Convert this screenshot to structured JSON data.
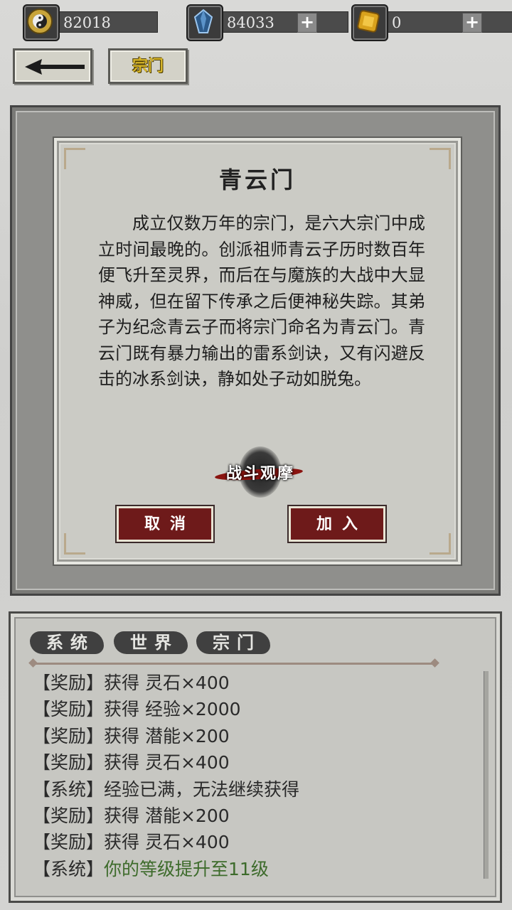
{
  "resources": {
    "coin": {
      "icon": "yin-yang-coin-icon",
      "value": "82018"
    },
    "gem": {
      "icon": "blue-crystal-icon",
      "value": "84033",
      "plus": "+"
    },
    "gold": {
      "icon": "gold-ingot-icon",
      "value": "0",
      "plus": "+"
    }
  },
  "nav": {
    "back_icon": "back-arrow-icon",
    "tab_label": "宗门"
  },
  "dialog": {
    "title": "青云门",
    "description": "成立仅数万年的宗门，是六大宗门中成立时间最晚的。创派祖师青云子历时数百年便飞升至灵界，而后在与魔族的大战中大显神威，但在留下传承之后便神秘失踪。其弟子为纪念青云子而将宗门命名为青云门。青云门既有暴力输出的雷系剑诀，又有闪避反击的冰系剑诀，静如处子动如脱兔。",
    "battle_watch": "战斗观摩",
    "cancel": "取消",
    "join": "加入"
  },
  "chat": {
    "tabs": [
      "系统",
      "世界",
      "宗门"
    ],
    "messages": [
      {
        "tag": "【奖励】",
        "text": "获得 灵石×400",
        "color": "default"
      },
      {
        "tag": "【奖励】",
        "text": "获得 经验×2000",
        "color": "default"
      },
      {
        "tag": "【奖励】",
        "text": "获得 潜能×200",
        "color": "default"
      },
      {
        "tag": "【奖励】",
        "text": "获得 灵石×400",
        "color": "default"
      },
      {
        "tag": "【系统】",
        "text": "经验已满，无法继续获得",
        "color": "default"
      },
      {
        "tag": "【奖励】",
        "text": "获得 潜能×200",
        "color": "default"
      },
      {
        "tag": "【奖励】",
        "text": "获得 灵石×400",
        "color": "default"
      },
      {
        "tag": "【系统】",
        "text": "你的等级提升至11级",
        "color": "#3d6b2b"
      }
    ]
  },
  "colors": {
    "accent_gold": "#d6b52a",
    "button_red": "#6e1a1a",
    "level_green": "#3d6b2b"
  }
}
